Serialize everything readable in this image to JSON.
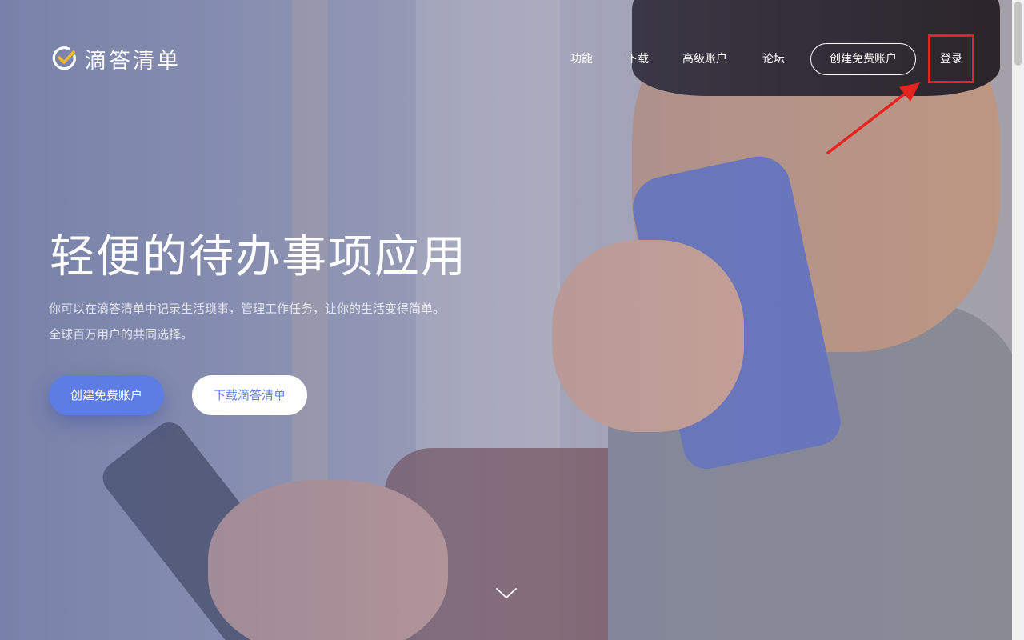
{
  "header": {
    "logo_text": "滴答清单",
    "nav": [
      {
        "label": "功能"
      },
      {
        "label": "下载"
      },
      {
        "label": "高级账户"
      },
      {
        "label": "论坛"
      }
    ],
    "cta_label": "创建免费账户",
    "login_label": "登录"
  },
  "hero": {
    "headline": "轻便的待办事项应用",
    "subline_1": "你可以在滴答清单中记录生活琐事，管理工作任务，让你的生活变得简单。",
    "subline_2": "全球百万用户的共同选择。",
    "primary_button": "创建免费账户",
    "secondary_button": "下载滴答清单",
    "scroll_icon": "chevron-down-icon"
  },
  "colors": {
    "brand_blue": "#5d7de4",
    "logo_check": "#f5b82e",
    "highlight_red": "#e8231f"
  }
}
